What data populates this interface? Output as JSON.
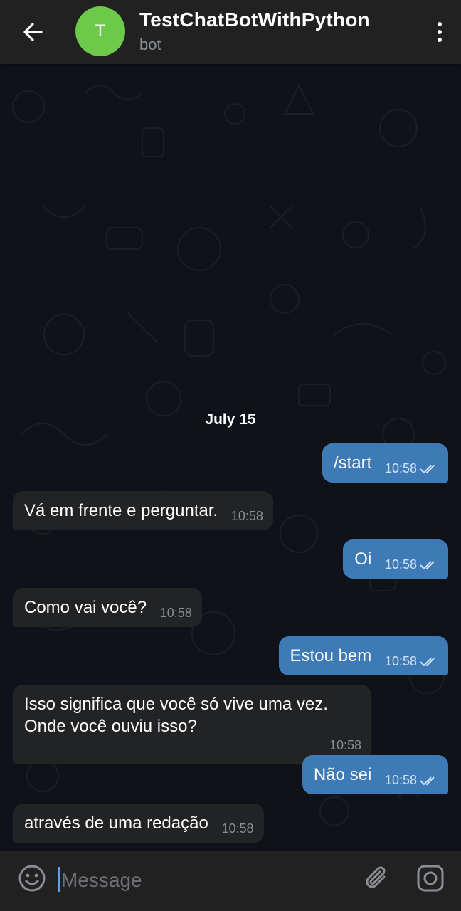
{
  "header": {
    "back_icon": "arrow-left-icon",
    "avatar_letter": "T",
    "avatar_color": "#6cc94a",
    "title": "TestChatBotWithPython",
    "subtitle": "bot",
    "menu_icon": "more-vertical-icon"
  },
  "chat": {
    "date_separator": "July 15",
    "messages": [
      {
        "direction": "out",
        "text": "/start",
        "time": "10:58",
        "status": "read"
      },
      {
        "direction": "in",
        "text": "Vá em frente e perguntar.",
        "time": "10:58"
      },
      {
        "direction": "out",
        "text": "Oi",
        "time": "10:58",
        "status": "read"
      },
      {
        "direction": "in",
        "text": "Como vai você?",
        "time": "10:58"
      },
      {
        "direction": "out",
        "text": "Estou bem",
        "time": "10:58",
        "status": "read"
      },
      {
        "direction": "in",
        "text_line1": "Isso significa que você só vive uma vez.",
        "text_line2": "Onde você ouviu isso?",
        "time": "10:58"
      },
      {
        "direction": "out",
        "text": "Não sei",
        "time": "10:58",
        "status": "read"
      },
      {
        "direction": "in",
        "text": "através de uma redação",
        "time": "10:58"
      }
    ]
  },
  "input": {
    "placeholder": "Message",
    "emoji_icon": "smile-icon",
    "attach_icon": "paperclip-icon",
    "camera_icon": "camera-icon"
  },
  "colors": {
    "outgoing_bubble": "#3e7ab5",
    "incoming_bubble": "#222325",
    "header_bg": "#212121",
    "chat_bg": "#0f1319"
  }
}
